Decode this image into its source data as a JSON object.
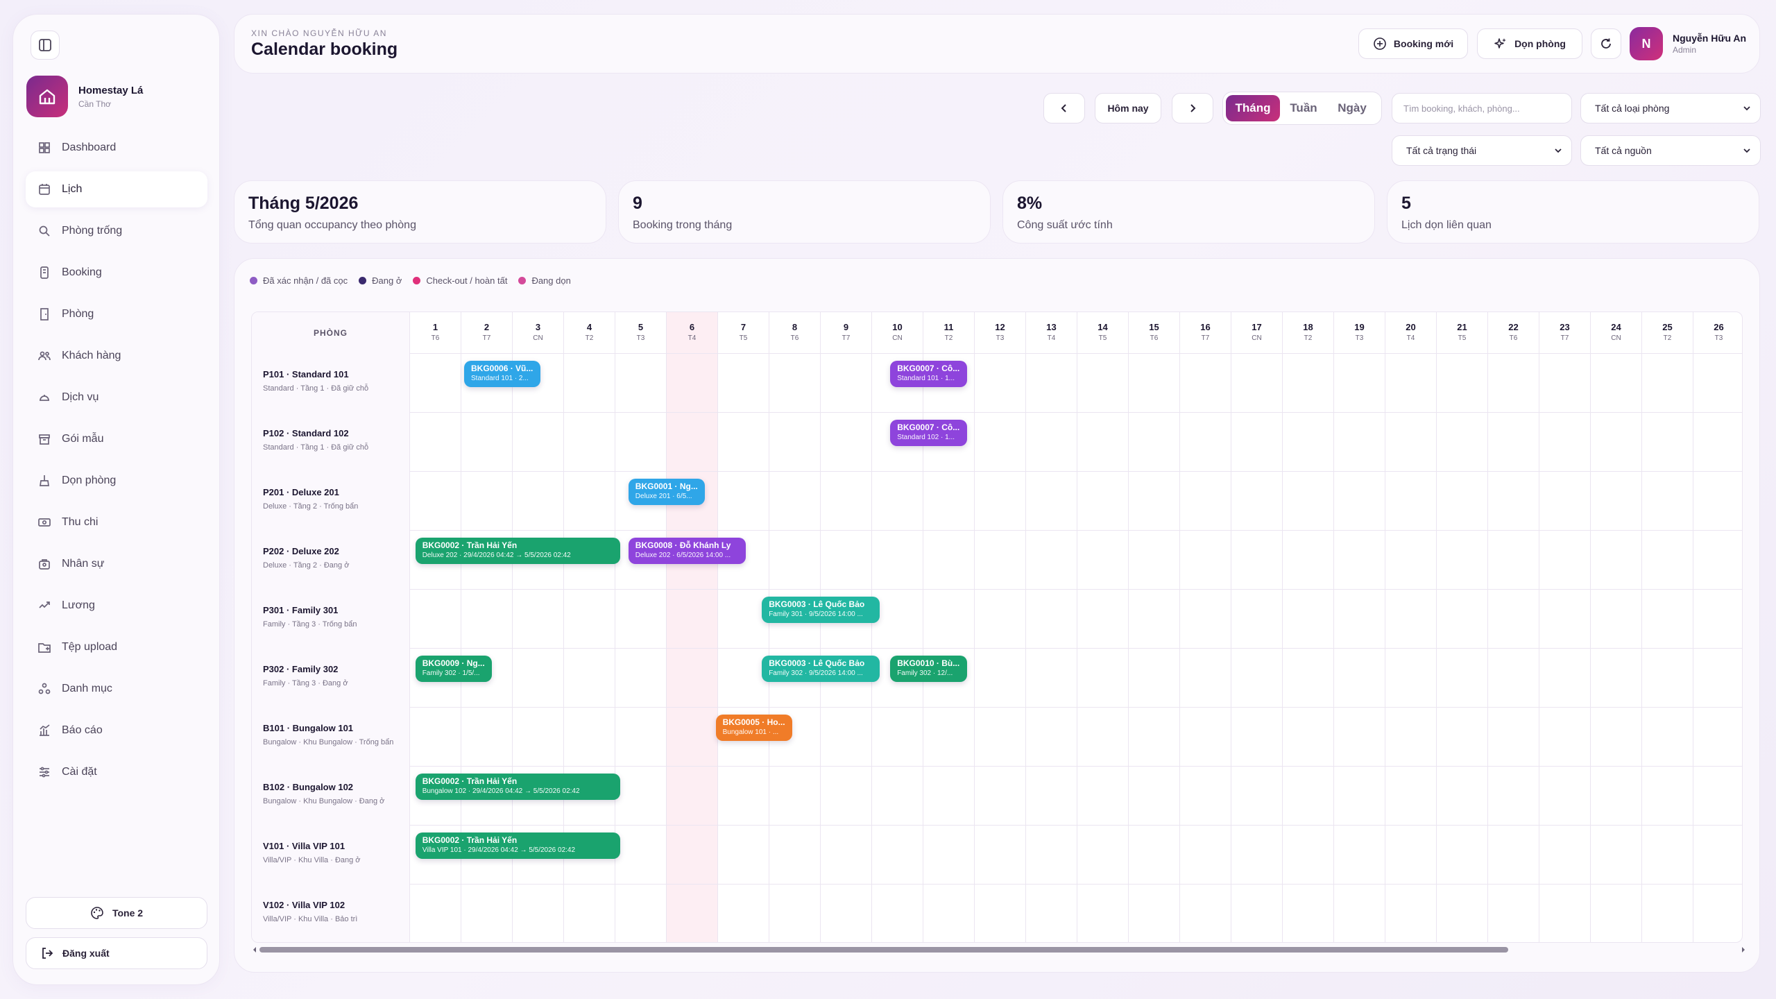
{
  "sidebar": {
    "brand_name": "Homestay Lá",
    "brand_city": "Cần Thơ",
    "items": [
      {
        "label": "Dashboard",
        "icon": "dashboard-icon"
      },
      {
        "label": "Lịch",
        "icon": "calendar-icon",
        "active": true
      },
      {
        "label": "Phòng trống",
        "icon": "search-icon"
      },
      {
        "label": "Booking",
        "icon": "booking-icon"
      },
      {
        "label": "Phòng",
        "icon": "door-icon"
      },
      {
        "label": "Khách hàng",
        "icon": "users-icon"
      },
      {
        "label": "Dịch vụ",
        "icon": "service-icon"
      },
      {
        "label": "Gói mẫu",
        "icon": "package-icon"
      },
      {
        "label": "Dọn phòng",
        "icon": "broom-icon"
      },
      {
        "label": "Thu chi",
        "icon": "money-icon"
      },
      {
        "label": "Nhân sự",
        "icon": "staff-icon"
      },
      {
        "label": "Lương",
        "icon": "salary-icon"
      },
      {
        "label": "Tệp upload",
        "icon": "folder-icon"
      },
      {
        "label": "Danh mục",
        "icon": "category-icon"
      },
      {
        "label": "Báo cáo",
        "icon": "report-icon"
      },
      {
        "label": "Cài đặt",
        "icon": "settings-icon"
      }
    ],
    "tone_label": "Tone 2",
    "logout_label": "Đăng xuất"
  },
  "header": {
    "greeting": "XIN CHÀO NGUYỄN HỮU AN",
    "title": "Calendar booking",
    "new_booking_label": "Booking mới",
    "cleaning_label": "Dọn phòng",
    "user_initial": "N",
    "user_name": "Nguyễn Hữu An",
    "user_role": "Admin"
  },
  "toolbar": {
    "today_label": "Hôm nay",
    "view_tabs": [
      "Tháng",
      "Tuần",
      "Ngày"
    ],
    "active_view": "Tháng",
    "search_placeholder": "Tìm booking, khách, phòng...",
    "room_type_filter": "Tất cả loại phòng",
    "status_filter": "Tất cả trạng thái",
    "source_filter": "Tất cả nguồn"
  },
  "stats": [
    {
      "value": "Tháng 5/2026",
      "label": "Tổng quan occupancy theo phòng"
    },
    {
      "value": "9",
      "label": "Booking trong tháng"
    },
    {
      "value": "8%",
      "label": "Công suất ước tính"
    },
    {
      "value": "5",
      "label": "Lịch dọn liên quan"
    }
  ],
  "legend": [
    {
      "label": "Đã xác nhận / đã cọc",
      "color": "#8e5cc4"
    },
    {
      "label": "Đang ở",
      "color": "#3b2a6e"
    },
    {
      "label": "Check-out / hoàn tất",
      "color": "#e0307a"
    },
    {
      "label": "Đang dọn",
      "color": "#d44a9a"
    }
  ],
  "calendar": {
    "room_header": "PHÒNG",
    "today_day": 6,
    "days": [
      {
        "d": "1",
        "w": "T6"
      },
      {
        "d": "2",
        "w": "T7"
      },
      {
        "d": "3",
        "w": "CN"
      },
      {
        "d": "4",
        "w": "T2"
      },
      {
        "d": "5",
        "w": "T3"
      },
      {
        "d": "6",
        "w": "T4"
      },
      {
        "d": "7",
        "w": "T5"
      },
      {
        "d": "8",
        "w": "T6"
      },
      {
        "d": "9",
        "w": "T7"
      },
      {
        "d": "10",
        "w": "CN"
      },
      {
        "d": "11",
        "w": "T2"
      },
      {
        "d": "12",
        "w": "T3"
      },
      {
        "d": "13",
        "w": "T4"
      },
      {
        "d": "14",
        "w": "T5"
      },
      {
        "d": "15",
        "w": "T6"
      },
      {
        "d": "16",
        "w": "T7"
      },
      {
        "d": "17",
        "w": "CN"
      },
      {
        "d": "18",
        "w": "T2"
      },
      {
        "d": "19",
        "w": "T3"
      },
      {
        "d": "20",
        "w": "T4"
      },
      {
        "d": "21",
        "w": "T5"
      },
      {
        "d": "22",
        "w": "T6"
      },
      {
        "d": "23",
        "w": "T7"
      },
      {
        "d": "24",
        "w": "CN"
      },
      {
        "d": "25",
        "w": "T2"
      },
      {
        "d": "26",
        "w": "T3"
      }
    ],
    "rooms": [
      {
        "name": "P101 · Standard 101",
        "meta": "Standard · Tầng 1 · Đã giữ chỗ"
      },
      {
        "name": "P102 · Standard 102",
        "meta": "Standard · Tầng 1 · Đã giữ chỗ"
      },
      {
        "name": "P201 · Deluxe 201",
        "meta": "Deluxe · Tầng 2 · Trống bẩn"
      },
      {
        "name": "P202 · Deluxe 202",
        "meta": "Deluxe · Tầng 2 · Đang ở"
      },
      {
        "name": "P301 · Family 301",
        "meta": "Family · Tầng 3 · Trống bẩn"
      },
      {
        "name": "P302 · Family 302",
        "meta": "Family · Tầng 3 · Đang ở"
      },
      {
        "name": "B101 · Bungalow 101",
        "meta": "Bungalow · Khu Bungalow · Trống bẩn"
      },
      {
        "name": "B102 · Bungalow 102",
        "meta": "Bungalow · Khu Bungalow · Đang ở"
      },
      {
        "name": "V101 · Villa VIP 101",
        "meta": "Villa/VIP · Khu Villa · Đang ở"
      },
      {
        "name": "V102 · Villa VIP 102",
        "meta": "Villa/VIP · Khu Villa · Bảo trì"
      }
    ],
    "bookings": [
      {
        "row": 0,
        "start": 1,
        "span": 1.6,
        "title": "BKG0006 · Vũ...",
        "sub": "Standard 101 · 2...",
        "color": "#2fa6e8"
      },
      {
        "row": 0,
        "start": 9.3,
        "span": 1.6,
        "title": "BKG0007 · Cô...",
        "sub": "Standard 101 · 1...",
        "color": "#8e44dc"
      },
      {
        "row": 1,
        "start": 9.3,
        "span": 1.6,
        "title": "BKG0007 · Cô...",
        "sub": "Standard 102 · 1...",
        "color": "#8e44dc"
      },
      {
        "row": 2,
        "start": 4.2,
        "span": 1.6,
        "title": "BKG0001 · Ng...",
        "sub": "Deluxe 201 · 6/5...",
        "color": "#2fa6e8"
      },
      {
        "row": 3,
        "start": 0.05,
        "span": 4.1,
        "title": "BKG0002 · Trần Hải Yến",
        "sub": "Deluxe 202 · 29/4/2026 04:42 → 5/5/2026 02:42",
        "color": "#1aa36e"
      },
      {
        "row": 3,
        "start": 4.2,
        "span": 2.4,
        "title": "BKG0008 · Đỗ Khánh Ly",
        "sub": "Deluxe 202 · 6/5/2026 14:00 ...",
        "color": "#8e44dc"
      },
      {
        "row": 4,
        "start": 6.8,
        "span": 2.4,
        "title": "BKG0003 · Lê Quốc Bảo",
        "sub": "Family 301 · 9/5/2026 14:00 ...",
        "color": "#22b7a2"
      },
      {
        "row": 5,
        "start": 0.05,
        "span": 1.6,
        "title": "BKG0009 · Ng...",
        "sub": "Family 302 · 1/5/...",
        "color": "#1aa36e"
      },
      {
        "row": 5,
        "start": 6.8,
        "span": 2.4,
        "title": "BKG0003 · Lê Quốc Bảo",
        "sub": "Family 302 · 9/5/2026 14:00 ...",
        "color": "#22b7a2"
      },
      {
        "row": 5,
        "start": 9.3,
        "span": 1.6,
        "title": "BKG0010 · Bù...",
        "sub": "Family 302 · 12/...",
        "color": "#1aa36e"
      },
      {
        "row": 6,
        "start": 5.9,
        "span": 1.6,
        "title": "BKG0005 · Ho...",
        "sub": "Bungalow 101 · ...",
        "color": "#f07c28"
      },
      {
        "row": 7,
        "start": 0.05,
        "span": 4.1,
        "title": "BKG0002 · Trần Hải Yến",
        "sub": "Bungalow 102 · 29/4/2026 04:42 → 5/5/2026 02:42",
        "color": "#1aa36e"
      },
      {
        "row": 8,
        "start": 0.05,
        "span": 4.1,
        "title": "BKG0002 · Trần Hải Yến",
        "sub": "Villa VIP 101 · 29/4/2026 04:42 → 5/5/2026 02:42",
        "color": "#1aa36e"
      }
    ]
  }
}
